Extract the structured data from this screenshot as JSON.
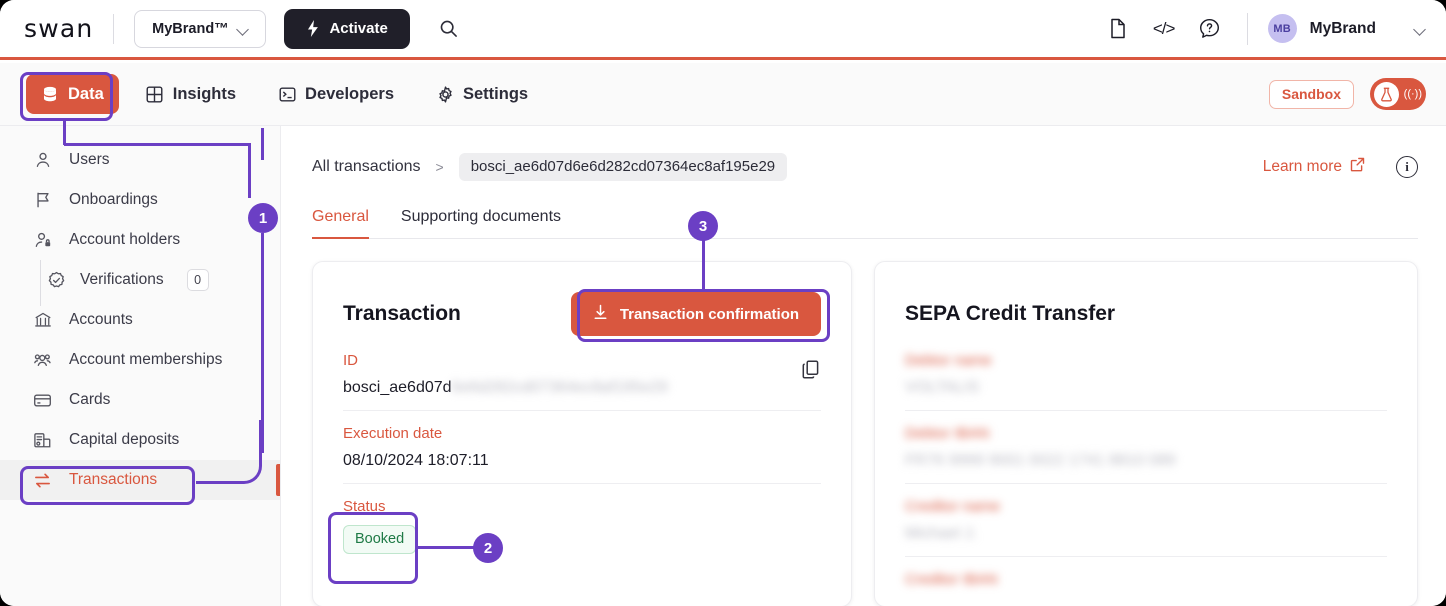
{
  "header": {
    "logo": "swan",
    "brand_selector": "MyBrand™",
    "activate_label": "Activate",
    "search_icon": "search-icon",
    "doc_icon": "document-icon",
    "code_icon": "</>",
    "help_icon": "?",
    "avatar_initials": "MB",
    "user_name": "MyBrand"
  },
  "nav": {
    "items": [
      {
        "label": "Data",
        "icon": "database-icon",
        "active": true
      },
      {
        "label": "Insights",
        "icon": "grid-icon",
        "active": false
      },
      {
        "label": "Developers",
        "icon": "terminal-icon",
        "active": false
      },
      {
        "label": "Settings",
        "icon": "gear-icon",
        "active": false
      }
    ],
    "sandbox_label": "Sandbox",
    "env_toggle_icon": "flask-icon",
    "env_wave_icon": "broadcast-icon"
  },
  "sidebar": {
    "items": [
      {
        "label": "Users",
        "icon": "user-icon",
        "sub": false,
        "active": false
      },
      {
        "label": "Onboardings",
        "icon": "flag-icon",
        "sub": false,
        "active": false
      },
      {
        "label": "Account holders",
        "icon": "user-lock-icon",
        "sub": false,
        "active": false
      },
      {
        "label": "Verifications",
        "icon": "badge-check-icon",
        "sub": true,
        "active": false,
        "count": "0"
      },
      {
        "label": "Accounts",
        "icon": "bank-icon",
        "sub": false,
        "active": false
      },
      {
        "label": "Account memberships",
        "icon": "users-group-icon",
        "sub": false,
        "active": false
      },
      {
        "label": "Cards",
        "icon": "card-icon",
        "sub": false,
        "active": false
      },
      {
        "label": "Capital deposits",
        "icon": "capital-deposit-icon",
        "sub": false,
        "active": false
      },
      {
        "label": "Transactions",
        "icon": "transfer-arrows-icon",
        "sub": false,
        "active": true
      }
    ]
  },
  "breadcrumb": {
    "root": "All transactions",
    "separator": ">",
    "current_id": "bosci_ae6d07d6e6d282cd07364ec8af195e29"
  },
  "learn_more": {
    "label": "Learn more",
    "external_icon": "external-link-icon",
    "info_icon": "info-icon",
    "info_glyph": "i"
  },
  "tabs": [
    {
      "label": "General",
      "active": true
    },
    {
      "label": "Supporting documents",
      "active": false
    }
  ],
  "transaction_card": {
    "title": "Transaction",
    "confirm_button": "Transaction confirmation",
    "download_icon": "download-icon",
    "copy_icon": "copy-icon",
    "fields": [
      {
        "label": "ID",
        "value": "bosci_ae6d07d",
        "masked_value": "6e6d282cd07364ec8af195e29",
        "masked": false
      },
      {
        "label": "Execution date",
        "value": "08/10/2024 18:07:11",
        "masked": false
      },
      {
        "label": "Status",
        "value": "Booked",
        "type": "chip"
      }
    ]
  },
  "sepa_card": {
    "title": "SEPA Credit Transfer",
    "fields": [
      {
        "label": "Debtor name",
        "value": "VOLTALIS",
        "masked": true
      },
      {
        "label": "Debtor IBAN",
        "value": "FR76 9999 9001 0022 1741 8810 089",
        "masked": true
      },
      {
        "label": "Creditor name",
        "value": "Michael J.",
        "masked": true
      },
      {
        "label": "Creditor IBAN",
        "value": "",
        "masked": true
      }
    ]
  },
  "annotations": {
    "badges": [
      {
        "number": "1"
      },
      {
        "number": "2"
      },
      {
        "number": "3"
      }
    ]
  },
  "colors": {
    "accent_red": "#d9573f",
    "annotation_purple": "#6b3fc4",
    "status_green": "#1f7a46",
    "dark": "#201f29"
  }
}
